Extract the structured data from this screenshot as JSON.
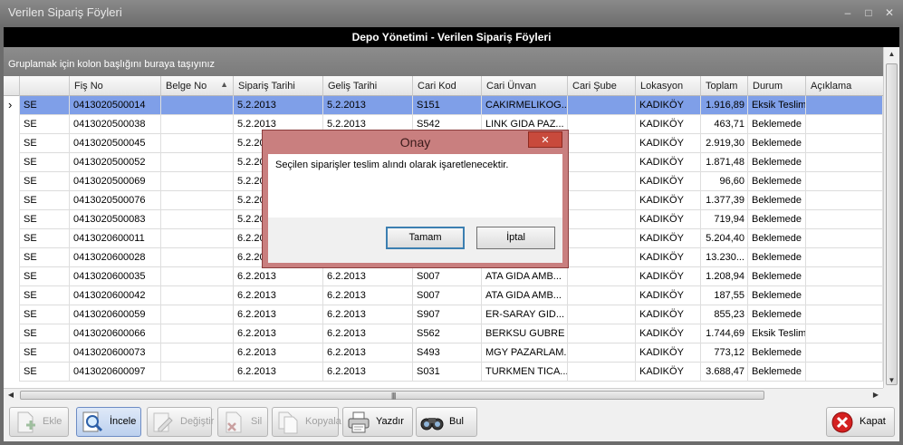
{
  "window": {
    "title": "Verilen Sipariş Föyleri",
    "minimize": "–",
    "maximize": "□",
    "close": "✕"
  },
  "header": {
    "title": "Depo Yönetimi - Verilen Sipariş Föyleri"
  },
  "group_panel": {
    "text": "Gruplamak için kolon başlığını buraya taşıyınız"
  },
  "columns": [
    "",
    "Fiş No",
    "Belge No",
    "Sipariş Tarihi",
    "Geliş Tarihi",
    "Cari Kod",
    "Cari Ünvan",
    "Cari Şube",
    "Lokasyon",
    "Toplam",
    "Durum",
    "Açıklama"
  ],
  "sort_indicator": "▲",
  "selected_marker": "›",
  "rows": [
    [
      "SE",
      "0413020500014",
      "",
      "5.2.2013",
      "5.2.2013",
      "S151",
      "CAKIRMELIKOG...",
      "",
      "KADIKÖY",
      "1.916,89",
      "Eksik Teslim",
      ""
    ],
    [
      "SE",
      "0413020500038",
      "",
      "5.2.2013",
      "5.2.2013",
      "S542",
      "LINK GIDA PAZ...",
      "",
      "KADIKÖY",
      "463,71",
      "Beklemede",
      ""
    ],
    [
      "SE",
      "0413020500045",
      "",
      "5.2.2013",
      "",
      "",
      "",
      "",
      "KADIKÖY",
      "2.919,30",
      "Beklemede",
      ""
    ],
    [
      "SE",
      "0413020500052",
      "",
      "5.2.2013",
      "",
      "",
      "",
      "",
      "KADIKÖY",
      "1.871,48",
      "Beklemede",
      ""
    ],
    [
      "SE",
      "0413020500069",
      "",
      "5.2.2013",
      "",
      "",
      "",
      "",
      "KADIKÖY",
      "96,60",
      "Beklemede",
      ""
    ],
    [
      "SE",
      "0413020500076",
      "",
      "5.2.2013",
      "",
      "",
      "",
      "",
      "KADIKÖY",
      "1.377,39",
      "Beklemede",
      ""
    ],
    [
      "SE",
      "0413020500083",
      "",
      "5.2.2013",
      "",
      "",
      "",
      "",
      "KADIKÖY",
      "719,94",
      "Beklemede",
      ""
    ],
    [
      "SE",
      "0413020600011",
      "",
      "6.2.2013",
      "",
      "",
      "",
      "",
      "KADIKÖY",
      "5.204,40",
      "Beklemede",
      ""
    ],
    [
      "SE",
      "0413020600028",
      "",
      "6.2.2013",
      "",
      "",
      "",
      "",
      "KADIKÖY",
      "13.230...",
      "Beklemede",
      ""
    ],
    [
      "SE",
      "0413020600035",
      "",
      "6.2.2013",
      "6.2.2013",
      "S007",
      "ATA GIDA AMB...",
      "",
      "KADIKÖY",
      "1.208,94",
      "Beklemede",
      ""
    ],
    [
      "SE",
      "0413020600042",
      "",
      "6.2.2013",
      "6.2.2013",
      "S007",
      "ATA GIDA AMB...",
      "",
      "KADIKÖY",
      "187,55",
      "Beklemede",
      ""
    ],
    [
      "SE",
      "0413020600059",
      "",
      "6.2.2013",
      "6.2.2013",
      "S907",
      "ER-SARAY GID...",
      "",
      "KADIKÖY",
      "855,23",
      "Beklemede",
      ""
    ],
    [
      "SE",
      "0413020600066",
      "",
      "6.2.2013",
      "6.2.2013",
      "S562",
      "BERKSU GUBRE ...",
      "",
      "KADIKÖY",
      "1.744,69",
      "Eksik Teslim",
      ""
    ],
    [
      "SE",
      "0413020600073",
      "",
      "6.2.2013",
      "6.2.2013",
      "S493",
      "MGY PAZARLAM...",
      "",
      "KADIKÖY",
      "773,12",
      "Beklemede",
      ""
    ],
    [
      "SE",
      "0413020600097",
      "",
      "6.2.2013",
      "6.2.2013",
      "S031",
      "TURKMEN TICA...",
      "",
      "KADIKÖY",
      "3.688,47",
      "Beklemede",
      ""
    ]
  ],
  "scroll": {
    "up": "▲",
    "down": "▼",
    "left": "◀",
    "right": "▶",
    "grip": "||||"
  },
  "toolbar": {
    "ekle": "Ekle",
    "incele": "İncele",
    "degistir": "Değiştir",
    "sil": "Sil",
    "kopyala": "Kopyala",
    "yazdir": "Yazdır",
    "bul": "Bul",
    "kapat": "Kapat"
  },
  "dialog": {
    "title": "Onay",
    "close": "✕",
    "message": "Seçilen siparişler teslim alındı olarak işaretlenecektir.",
    "ok": "Tamam",
    "cancel": "İptal"
  }
}
